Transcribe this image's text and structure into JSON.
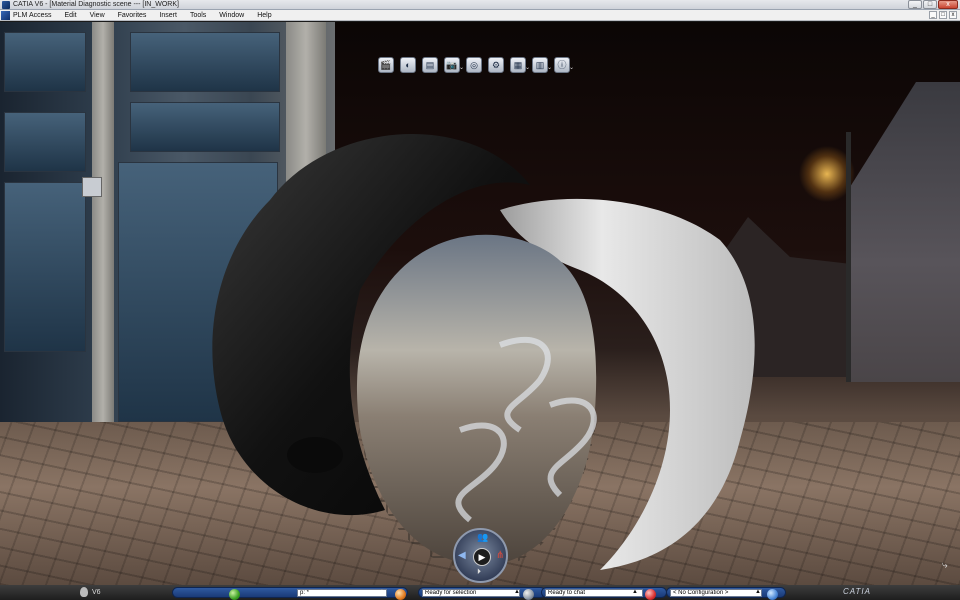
{
  "window": {
    "title": "CATIA V6 - [Material Diagnostic scene --- [IN_WORK]",
    "controls": {
      "minimize": "_",
      "maximize": "□",
      "close": "x"
    }
  },
  "menubar": {
    "items": [
      "PLM Access",
      "Edit",
      "View",
      "Favorites",
      "Insert",
      "Tools",
      "Window",
      "Help"
    ],
    "doc_controls": {
      "minimize": "_",
      "restore": "□",
      "close": "x"
    }
  },
  "toolbar": {
    "icons": [
      {
        "name": "clapperboard-icon",
        "glyph": "🎬",
        "has_dropdown": false
      },
      {
        "name": "material-icon",
        "glyph": "◐",
        "has_dropdown": false
      },
      {
        "name": "environment-icon",
        "glyph": "▤",
        "has_dropdown": false
      },
      {
        "name": "camera-icon",
        "glyph": "📷",
        "has_dropdown": true
      },
      {
        "name": "lens-icon",
        "glyph": "◎",
        "has_dropdown": false
      },
      {
        "name": "settings-gears-icon",
        "glyph": "⚙",
        "has_dropdown": false
      },
      {
        "name": "scene-database-icon",
        "glyph": "▦",
        "has_dropdown": true
      },
      {
        "name": "render-database-icon",
        "glyph": "▥",
        "has_dropdown": true
      },
      {
        "name": "info-screen-icon",
        "glyph": "ⓘ",
        "has_dropdown": true
      }
    ],
    "caret": "⌄"
  },
  "compass": {
    "play_glyph": "▶",
    "people_glyph": "👥",
    "share_glyph": "⋔",
    "left_glyph": "◀",
    "step_glyph": "⏵"
  },
  "corner_glyph": "⤷",
  "statusbar": {
    "v6_label": "V6",
    "power_input": "p: *",
    "status_message": "Ready for selection",
    "chat_message": "Ready to chat",
    "configuration": "< No Configuration >",
    "dropdown_glyph": "▲",
    "brand": "CATIA"
  },
  "colors": {
    "statusbar_pane": "#2f5aa0",
    "titlebar": "#d6dae0",
    "menubar": "#f0f0f0"
  }
}
